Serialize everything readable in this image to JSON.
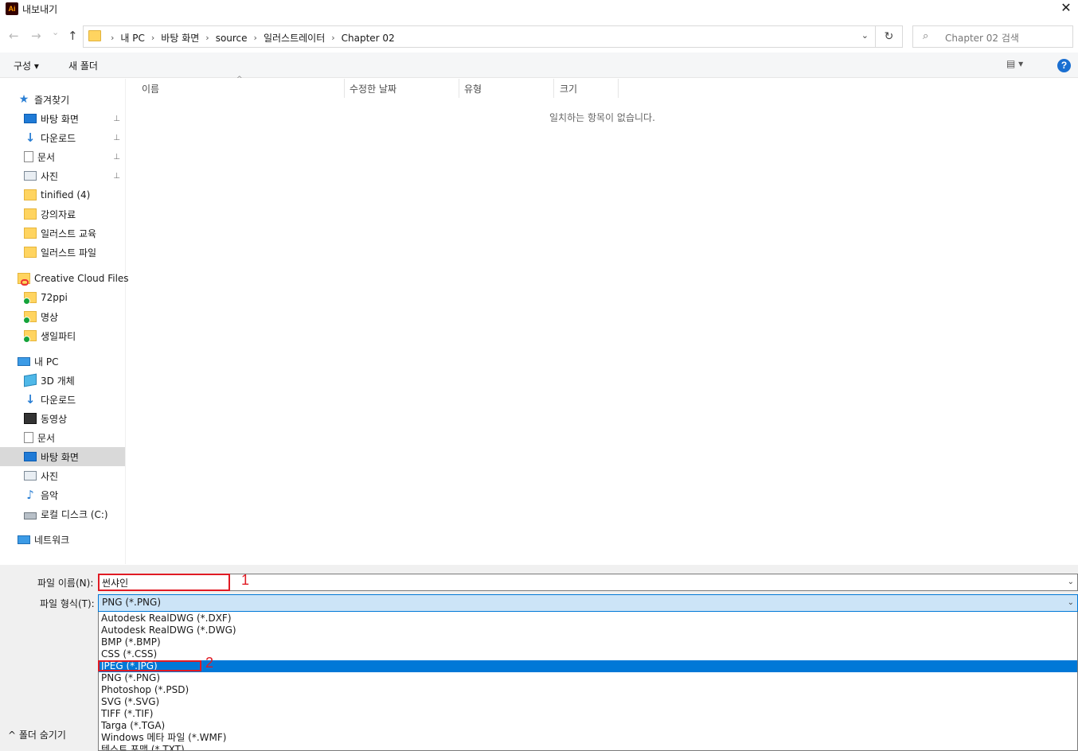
{
  "window": {
    "title": "내보내기",
    "app_icon": "Ai",
    "close": "✕"
  },
  "nav_buttons": {
    "back": "←",
    "forward": "→",
    "recent": "⌄",
    "up": "↑"
  },
  "address": {
    "crumbs": [
      "내 PC",
      "바탕 화면",
      "source",
      "일러스트레이터",
      "Chapter 02"
    ],
    "separator": "›",
    "dropdown": "⌄",
    "refresh": "↻"
  },
  "search": {
    "placeholder": "Chapter 02 검색",
    "icon": "⌕"
  },
  "toolbar": {
    "organize": "구성 ▾",
    "new_folder": "새 폴더",
    "view": "▤ ▾",
    "help": "?"
  },
  "sidebar": {
    "items": [
      {
        "label": "즐겨찾기",
        "icon": "star-icon"
      },
      {
        "label": "바탕 화면",
        "icon": "desktop-icon",
        "pinned": true
      },
      {
        "label": "다운로드",
        "icon": "download-icon",
        "pinned": true
      },
      {
        "label": "문서",
        "icon": "document-icon",
        "pinned": true
      },
      {
        "label": "사진",
        "icon": "picture-icon",
        "pinned": true
      },
      {
        "label": "tinified (4)",
        "icon": "folder-icon"
      },
      {
        "label": "강의자료",
        "icon": "folder-icon"
      },
      {
        "label": "일러스트 교육",
        "icon": "folder-icon"
      },
      {
        "label": "일러스트 파일",
        "icon": "folder-icon"
      },
      {
        "label": "Creative Cloud Files",
        "icon": "creative-cloud-folder-icon"
      },
      {
        "label": "72ppi",
        "icon": "synced-folder-icon"
      },
      {
        "label": "명상",
        "icon": "synced-folder-icon"
      },
      {
        "label": "생일파티",
        "icon": "synced-folder-icon"
      },
      {
        "label": "내 PC",
        "icon": "pc-icon"
      },
      {
        "label": "3D 개체",
        "icon": "3d-objects-icon"
      },
      {
        "label": "다운로드",
        "icon": "download-icon"
      },
      {
        "label": "동영상",
        "icon": "video-icon"
      },
      {
        "label": "문서",
        "icon": "document-icon"
      },
      {
        "label": "바탕 화면",
        "icon": "desktop-icon",
        "selected": true
      },
      {
        "label": "사진",
        "icon": "picture-icon"
      },
      {
        "label": "음악",
        "icon": "music-icon"
      },
      {
        "label": "로컬 디스크 (C:)",
        "icon": "disk-icon"
      },
      {
        "label": "네트워크",
        "icon": "network-icon"
      }
    ],
    "pin_glyph": "📌"
  },
  "columns": [
    "이름",
    "수정한 날짜",
    "유형",
    "크기"
  ],
  "sort_glyph": "^",
  "empty_message": "일치하는 항목이 없습니다.",
  "bottom": {
    "file_name_label": "파일 이름(N):",
    "file_name_value": "썬샤인",
    "file_type_label": "파일 형식(T):",
    "file_type_value": "PNG (*.PNG)",
    "dropdown_glyph": "⌄",
    "options": [
      "Autodesk RealDWG (*.DXF)",
      "Autodesk RealDWG (*.DWG)",
      "BMP (*.BMP)",
      "CSS (*.CSS)",
      "JPEG (*.JPG)",
      "PNG (*.PNG)",
      "Photoshop (*.PSD)",
      "SVG (*.SVG)",
      "TIFF (*.TIF)",
      "Targa (*.TGA)",
      "Windows 메타 파일 (*.WMF)",
      "텍스트 포맷 (*.TXT)"
    ],
    "selected_option": 4,
    "hide_folders": "^  폴더 숨기기",
    "annotations": [
      "1",
      "2"
    ],
    "colors": {
      "annotation": "#e01b24",
      "selection": "#0078d7"
    }
  }
}
